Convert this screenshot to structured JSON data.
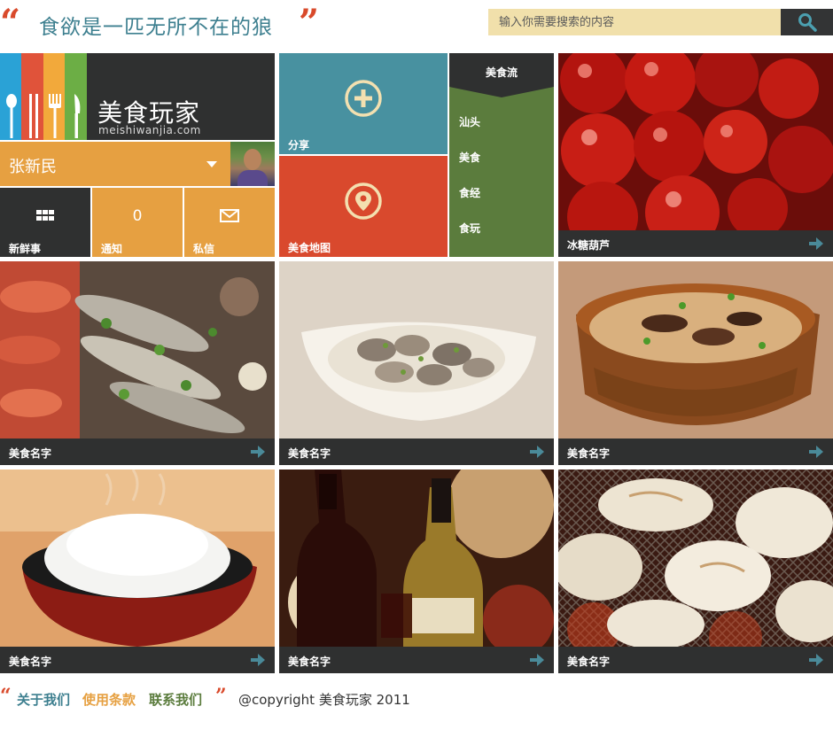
{
  "header": {
    "slogan": "食欲是一匹无所不在的狼",
    "search_placeholder": "输入你需要搜索的内容",
    "search_icon": "search-icon",
    "quote_color": "#d94a2b",
    "slogan_color": "#3d7f8f"
  },
  "brand": {
    "name": "美食玩家",
    "url": "meishiwanjia.com",
    "stripe_colors": [
      "#2aa2d6",
      "#e0533a",
      "#f2a93b",
      "#6cae45"
    ],
    "utensil_icons": [
      "spoon-icon",
      "chopsticks-icon",
      "fork-icon",
      "knife-icon"
    ]
  },
  "user": {
    "name": "张新民",
    "dropdown_icon": "caret-down-icon"
  },
  "quick_tiles": [
    {
      "id": "fresh",
      "label": "新鲜事",
      "icon": "grid-icon",
      "color": "#2f3030"
    },
    {
      "id": "notice",
      "label": "通知",
      "count": "0",
      "color": "#e6a041"
    },
    {
      "id": "mail",
      "label": "私信",
      "icon": "envelope-icon",
      "color": "#e6a041"
    }
  ],
  "share": {
    "label": "分享",
    "icon": "plus-circle-icon",
    "color": "#4891a0"
  },
  "map": {
    "label": "美食地图",
    "icon": "location-pin-icon",
    "color": "#d9492d"
  },
  "flow": {
    "title": "美食流",
    "items": [
      "汕头",
      "美食",
      "食经",
      "食玩"
    ],
    "color": "#5b7c3d"
  },
  "photos": [
    {
      "id": "candied-haws",
      "caption": "冰糖葫芦"
    },
    {
      "id": "seafood-platter",
      "caption": "美食名字"
    },
    {
      "id": "clam-bowl",
      "caption": "美食名字"
    },
    {
      "id": "rice-bowl-mushroom",
      "caption": "美食名字"
    },
    {
      "id": "white-rice",
      "caption": "美食名字"
    },
    {
      "id": "wine-bottles",
      "caption": "美食名字"
    },
    {
      "id": "grilled-dumplings",
      "caption": "美食名字"
    }
  ],
  "arrow_icon": "arrow-right-icon",
  "accent_arrow_color": "#4a8a99",
  "footer": {
    "links": [
      {
        "label": "关于我们",
        "color": "#3d7f8f"
      },
      {
        "label": "使用条款",
        "color": "#e6a041"
      },
      {
        "label": "联系我们",
        "color": "#5b7c3d"
      }
    ],
    "copyright": "@copyright 美食玩家 2011"
  }
}
